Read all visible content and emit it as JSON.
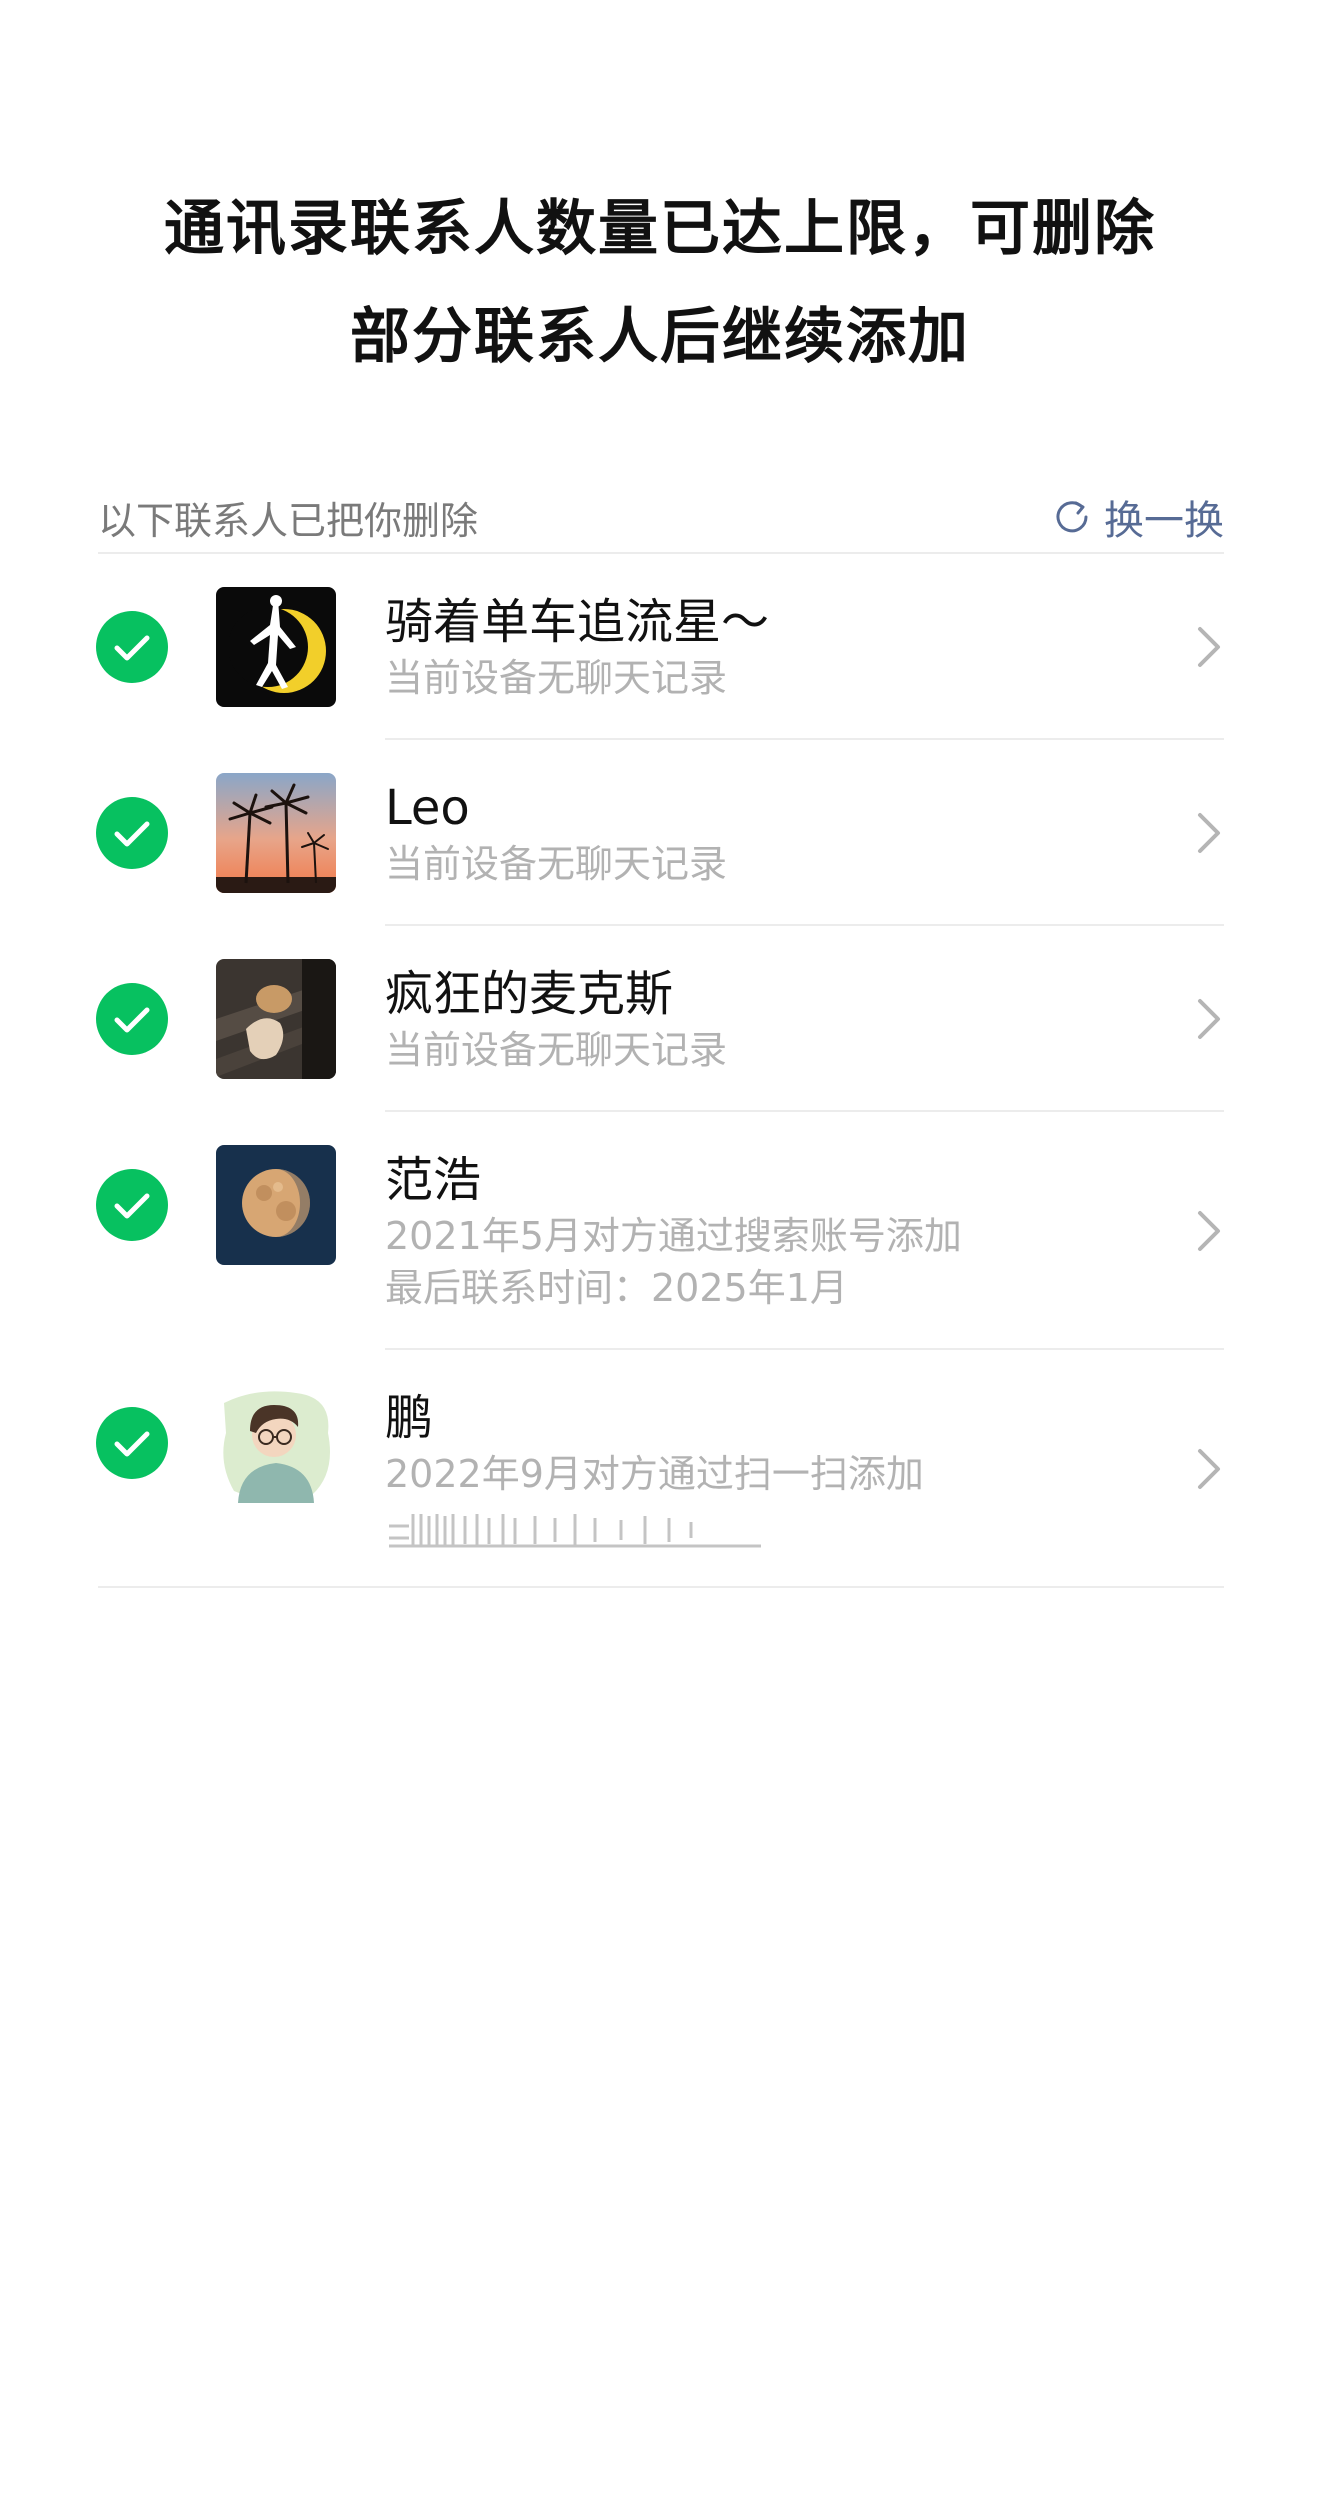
{
  "header": {
    "title_line1": "通讯录联系人数量已达上限，可删除",
    "title_line2": "部分联系人后继续添加"
  },
  "section": {
    "label": "以下联系人已把你删除",
    "refresh_label": "换一换",
    "refresh_icon": "refresh-icon"
  },
  "colors": {
    "check_green": "#07c160",
    "link_blue": "#576b95",
    "sub_text": "#b2b2b2"
  },
  "contacts": [
    {
      "selected": true,
      "name": "骑着单车追流星～",
      "lines": [
        "当前设备无聊天记录"
      ],
      "avatar": "sailor-moon-silhouette"
    },
    {
      "selected": true,
      "name": "Leo",
      "lines": [
        "当前设备无聊天记录"
      ],
      "avatar": "palm-trees-sunset"
    },
    {
      "selected": true,
      "name": "疯狂的麦克斯",
      "lines": [
        "当前设备无聊天记录"
      ],
      "avatar": "dark-photo-person"
    },
    {
      "selected": true,
      "name": "范浩",
      "lines": [
        "2021年5月对方通过搜索账号添加",
        "最后联系时间：2025年1月"
      ],
      "avatar": "moon-night-sky"
    },
    {
      "selected": true,
      "name": "鹏",
      "lines": [
        "2022年9月对方通过扫一扫添加"
      ],
      "avatar": "cartoon-boy-glasses"
    }
  ]
}
